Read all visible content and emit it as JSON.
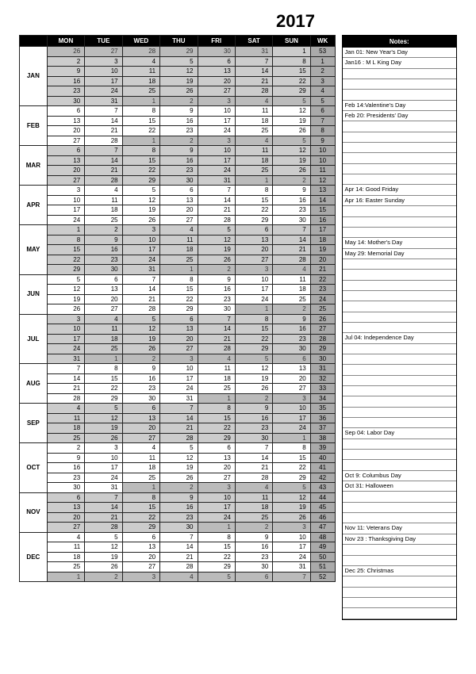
{
  "year": "2017",
  "headers": [
    "MON",
    "TUE",
    "WED",
    "THU",
    "FRI",
    "SAT",
    "SUN",
    "WK"
  ],
  "notes_title": "Notes:",
  "months": [
    {
      "label": "JAN",
      "grey": true,
      "weeks": [
        {
          "days": [
            26,
            27,
            28,
            29,
            30,
            31,
            1
          ],
          "outMask": [
            1,
            1,
            1,
            1,
            1,
            1,
            0
          ],
          "wk": 53
        },
        {
          "days": [
            2,
            3,
            4,
            5,
            6,
            7,
            8
          ],
          "outMask": [
            0,
            0,
            0,
            0,
            0,
            0,
            0
          ],
          "wk": 1
        },
        {
          "days": [
            9,
            10,
            11,
            12,
            13,
            14,
            15
          ],
          "outMask": [
            0,
            0,
            0,
            0,
            0,
            0,
            0
          ],
          "wk": 2
        },
        {
          "days": [
            16,
            17,
            18,
            19,
            20,
            21,
            22
          ],
          "outMask": [
            0,
            0,
            0,
            0,
            0,
            0,
            0
          ],
          "wk": 3
        },
        {
          "days": [
            23,
            24,
            25,
            26,
            27,
            28,
            29
          ],
          "outMask": [
            0,
            0,
            0,
            0,
            0,
            0,
            0
          ],
          "wk": 4
        },
        {
          "days": [
            30,
            31,
            1,
            2,
            3,
            4,
            5
          ],
          "outMask": [
            0,
            0,
            1,
            1,
            1,
            1,
            1
          ],
          "wk": 5
        }
      ]
    },
    {
      "label": "FEB",
      "grey": false,
      "weeks": [
        {
          "days": [
            6,
            7,
            8,
            9,
            10,
            11,
            12
          ],
          "outMask": [
            0,
            0,
            0,
            0,
            0,
            0,
            0
          ],
          "wk": 6
        },
        {
          "days": [
            13,
            14,
            15,
            16,
            17,
            18,
            19
          ],
          "outMask": [
            0,
            0,
            0,
            0,
            0,
            0,
            0
          ],
          "wk": 7
        },
        {
          "days": [
            20,
            21,
            22,
            23,
            24,
            25,
            26
          ],
          "outMask": [
            0,
            0,
            0,
            0,
            0,
            0,
            0
          ],
          "wk": 8
        },
        {
          "days": [
            27,
            28,
            1,
            2,
            3,
            4,
            5
          ],
          "outMask": [
            0,
            0,
            1,
            1,
            1,
            1,
            1
          ],
          "wk": 9
        }
      ]
    },
    {
      "label": "MAR",
      "grey": true,
      "weeks": [
        {
          "days": [
            6,
            7,
            8,
            9,
            10,
            11,
            12
          ],
          "outMask": [
            0,
            0,
            0,
            0,
            0,
            0,
            0
          ],
          "wk": 10
        },
        {
          "days": [
            13,
            14,
            15,
            16,
            17,
            18,
            19
          ],
          "outMask": [
            0,
            0,
            0,
            0,
            0,
            0,
            0
          ],
          "wk": 10
        },
        {
          "days": [
            20,
            21,
            22,
            23,
            24,
            25,
            26
          ],
          "outMask": [
            0,
            0,
            0,
            0,
            0,
            0,
            0
          ],
          "wk": 11
        },
        {
          "days": [
            27,
            28,
            29,
            30,
            31,
            1,
            2
          ],
          "outMask": [
            0,
            0,
            0,
            0,
            0,
            1,
            1
          ],
          "wk": 12
        }
      ]
    },
    {
      "label": "APR",
      "grey": false,
      "weeks": [
        {
          "days": [
            3,
            4,
            5,
            6,
            7,
            8,
            9
          ],
          "outMask": [
            0,
            0,
            0,
            0,
            0,
            0,
            0
          ],
          "wk": 13
        },
        {
          "days": [
            10,
            11,
            12,
            13,
            14,
            15,
            16
          ],
          "outMask": [
            0,
            0,
            0,
            0,
            0,
            0,
            0
          ],
          "wk": 14
        },
        {
          "days": [
            17,
            18,
            19,
            20,
            21,
            22,
            23
          ],
          "outMask": [
            0,
            0,
            0,
            0,
            0,
            0,
            0
          ],
          "wk": 15
        },
        {
          "days": [
            24,
            25,
            26,
            27,
            28,
            29,
            30
          ],
          "outMask": [
            0,
            0,
            0,
            0,
            0,
            0,
            0
          ],
          "wk": 16
        }
      ]
    },
    {
      "label": "MAY",
      "grey": true,
      "weeks": [
        {
          "days": [
            1,
            2,
            3,
            4,
            5,
            6,
            7
          ],
          "outMask": [
            0,
            0,
            0,
            0,
            0,
            0,
            0
          ],
          "wk": 17
        },
        {
          "days": [
            8,
            9,
            10,
            11,
            12,
            13,
            14
          ],
          "outMask": [
            0,
            0,
            0,
            0,
            0,
            0,
            0
          ],
          "wk": 18
        },
        {
          "days": [
            15,
            16,
            17,
            18,
            19,
            20,
            21
          ],
          "outMask": [
            0,
            0,
            0,
            0,
            0,
            0,
            0
          ],
          "wk": 19
        },
        {
          "days": [
            22,
            23,
            24,
            25,
            26,
            27,
            28
          ],
          "outMask": [
            0,
            0,
            0,
            0,
            0,
            0,
            0
          ],
          "wk": 20
        },
        {
          "days": [
            29,
            30,
            31,
            1,
            2,
            3,
            4
          ],
          "outMask": [
            0,
            0,
            0,
            1,
            1,
            1,
            1
          ],
          "wk": 21
        }
      ]
    },
    {
      "label": "JUN",
      "grey": false,
      "weeks": [
        {
          "days": [
            5,
            6,
            7,
            8,
            9,
            10,
            11
          ],
          "outMask": [
            0,
            0,
            0,
            0,
            0,
            0,
            0
          ],
          "wk": 22
        },
        {
          "days": [
            12,
            13,
            14,
            15,
            16,
            17,
            18
          ],
          "outMask": [
            0,
            0,
            0,
            0,
            0,
            0,
            0
          ],
          "wk": 23
        },
        {
          "days": [
            19,
            20,
            21,
            22,
            23,
            24,
            25
          ],
          "outMask": [
            0,
            0,
            0,
            0,
            0,
            0,
            0
          ],
          "wk": 24
        },
        {
          "days": [
            26,
            27,
            28,
            29,
            30,
            1,
            2
          ],
          "outMask": [
            0,
            0,
            0,
            0,
            0,
            1,
            1
          ],
          "wk": 25
        }
      ]
    },
    {
      "label": "JUL",
      "grey": true,
      "weeks": [
        {
          "days": [
            3,
            4,
            5,
            6,
            7,
            8,
            9
          ],
          "outMask": [
            0,
            0,
            0,
            0,
            0,
            0,
            0
          ],
          "wk": 26
        },
        {
          "days": [
            10,
            11,
            12,
            13,
            14,
            15,
            16
          ],
          "outMask": [
            0,
            0,
            0,
            0,
            0,
            0,
            0
          ],
          "wk": 27
        },
        {
          "days": [
            17,
            18,
            19,
            20,
            21,
            22,
            23
          ],
          "outMask": [
            0,
            0,
            0,
            0,
            0,
            0,
            0
          ],
          "wk": 28
        },
        {
          "days": [
            24,
            25,
            26,
            27,
            28,
            29,
            30
          ],
          "outMask": [
            0,
            0,
            0,
            0,
            0,
            0,
            0
          ],
          "wk": 29
        },
        {
          "days": [
            31,
            1,
            2,
            3,
            4,
            5,
            6
          ],
          "outMask": [
            0,
            1,
            1,
            1,
            1,
            1,
            1
          ],
          "wk": 30
        }
      ]
    },
    {
      "label": "AUG",
      "grey": false,
      "weeks": [
        {
          "days": [
            7,
            8,
            9,
            10,
            11,
            12,
            13
          ],
          "outMask": [
            0,
            0,
            0,
            0,
            0,
            0,
            0
          ],
          "wk": 31
        },
        {
          "days": [
            14,
            15,
            16,
            17,
            18,
            19,
            20
          ],
          "outMask": [
            0,
            0,
            0,
            0,
            0,
            0,
            0
          ],
          "wk": 32
        },
        {
          "days": [
            21,
            22,
            23,
            24,
            25,
            26,
            27
          ],
          "outMask": [
            0,
            0,
            0,
            0,
            0,
            0,
            0
          ],
          "wk": 33
        },
        {
          "days": [
            28,
            29,
            30,
            31,
            1,
            2,
            3
          ],
          "outMask": [
            0,
            0,
            0,
            0,
            1,
            1,
            1
          ],
          "wk": 34
        }
      ]
    },
    {
      "label": "SEP",
      "grey": true,
      "weeks": [
        {
          "days": [
            4,
            5,
            6,
            7,
            8,
            9,
            10
          ],
          "outMask": [
            0,
            0,
            0,
            0,
            0,
            0,
            0
          ],
          "wk": 35
        },
        {
          "days": [
            11,
            12,
            13,
            14,
            15,
            16,
            17
          ],
          "outMask": [
            0,
            0,
            0,
            0,
            0,
            0,
            0
          ],
          "wk": 36
        },
        {
          "days": [
            18,
            19,
            20,
            21,
            22,
            23,
            24
          ],
          "outMask": [
            0,
            0,
            0,
            0,
            0,
            0,
            0
          ],
          "wk": 37
        },
        {
          "days": [
            25,
            26,
            27,
            28,
            29,
            30,
            1
          ],
          "outMask": [
            0,
            0,
            0,
            0,
            0,
            0,
            1
          ],
          "wk": 38
        }
      ]
    },
    {
      "label": "OCT",
      "grey": false,
      "weeks": [
        {
          "days": [
            2,
            3,
            4,
            5,
            6,
            7,
            8
          ],
          "outMask": [
            0,
            0,
            0,
            0,
            0,
            0,
            0
          ],
          "wk": 39
        },
        {
          "days": [
            9,
            10,
            11,
            12,
            13,
            14,
            15
          ],
          "outMask": [
            0,
            0,
            0,
            0,
            0,
            0,
            0
          ],
          "wk": 40
        },
        {
          "days": [
            16,
            17,
            18,
            19,
            20,
            21,
            22
          ],
          "outMask": [
            0,
            0,
            0,
            0,
            0,
            0,
            0
          ],
          "wk": 41
        },
        {
          "days": [
            23,
            24,
            25,
            26,
            27,
            28,
            29
          ],
          "outMask": [
            0,
            0,
            0,
            0,
            0,
            0,
            0
          ],
          "wk": 42
        },
        {
          "days": [
            30,
            31,
            1,
            2,
            3,
            4,
            5
          ],
          "outMask": [
            0,
            0,
            1,
            1,
            1,
            1,
            1
          ],
          "wk": 43
        }
      ]
    },
    {
      "label": "NOV",
      "grey": true,
      "weeks": [
        {
          "days": [
            6,
            7,
            8,
            9,
            10,
            11,
            12
          ],
          "outMask": [
            0,
            0,
            0,
            0,
            0,
            0,
            0
          ],
          "wk": 44
        },
        {
          "days": [
            13,
            14,
            15,
            16,
            17,
            18,
            19
          ],
          "outMask": [
            0,
            0,
            0,
            0,
            0,
            0,
            0
          ],
          "wk": 45
        },
        {
          "days": [
            20,
            21,
            22,
            23,
            24,
            25,
            26
          ],
          "outMask": [
            0,
            0,
            0,
            0,
            0,
            0,
            0
          ],
          "wk": 46
        },
        {
          "days": [
            27,
            28,
            29,
            30,
            1,
            2,
            3
          ],
          "outMask": [
            0,
            0,
            0,
            0,
            1,
            1,
            1
          ],
          "wk": 47
        }
      ]
    },
    {
      "label": "DEC",
      "grey": false,
      "weeks": [
        {
          "days": [
            4,
            5,
            6,
            7,
            8,
            9,
            10
          ],
          "outMask": [
            0,
            0,
            0,
            0,
            0,
            0,
            0
          ],
          "wk": 48
        },
        {
          "days": [
            11,
            12,
            13,
            14,
            15,
            16,
            17
          ],
          "outMask": [
            0,
            0,
            0,
            0,
            0,
            0,
            0
          ],
          "wk": 49
        },
        {
          "days": [
            18,
            19,
            20,
            21,
            22,
            23,
            24
          ],
          "outMask": [
            0,
            0,
            0,
            0,
            0,
            0,
            0
          ],
          "wk": 50
        },
        {
          "days": [
            25,
            26,
            27,
            28,
            29,
            30,
            31
          ],
          "outMask": [
            0,
            0,
            0,
            0,
            0,
            0,
            0
          ],
          "wk": 51
        },
        {
          "days": [
            1,
            2,
            3,
            4,
            5,
            6,
            7
          ],
          "outMask": [
            1,
            1,
            1,
            1,
            1,
            1,
            1
          ],
          "wk": 52
        }
      ]
    }
  ],
  "notes": [
    "Jan 01: New Year's Day",
    "Jan16 : M L King Day",
    "",
    "",
    "",
    "Feb 14:Valentine's Day",
    "Feb 20: Presidents' Day",
    "",
    "",
    "",
    "",
    "",
    "",
    "Apr 14: Good Friday",
    "Apr 16: Easter Sunday",
    "",
    "",
    "",
    "May 14: Mother's Day",
    "May 29: Memorial Day",
    "",
    "",
    "",
    "",
    "",
    "",
    "",
    "Jul 04: Independence Day",
    "",
    "",
    "",
    "",
    "",
    "",
    "",
    "",
    "Sep 04: Labor Day",
    "",
    "",
    "",
    "Oct 9: Columbus Day",
    "Oct 31: Halloween",
    "",
    "",
    "",
    "Nov 11: Veterans Day",
    "Nov 23 : Thanksgiving Day",
    "",
    "",
    "Dec 25: Christmas",
    "",
    "",
    "",
    ""
  ]
}
